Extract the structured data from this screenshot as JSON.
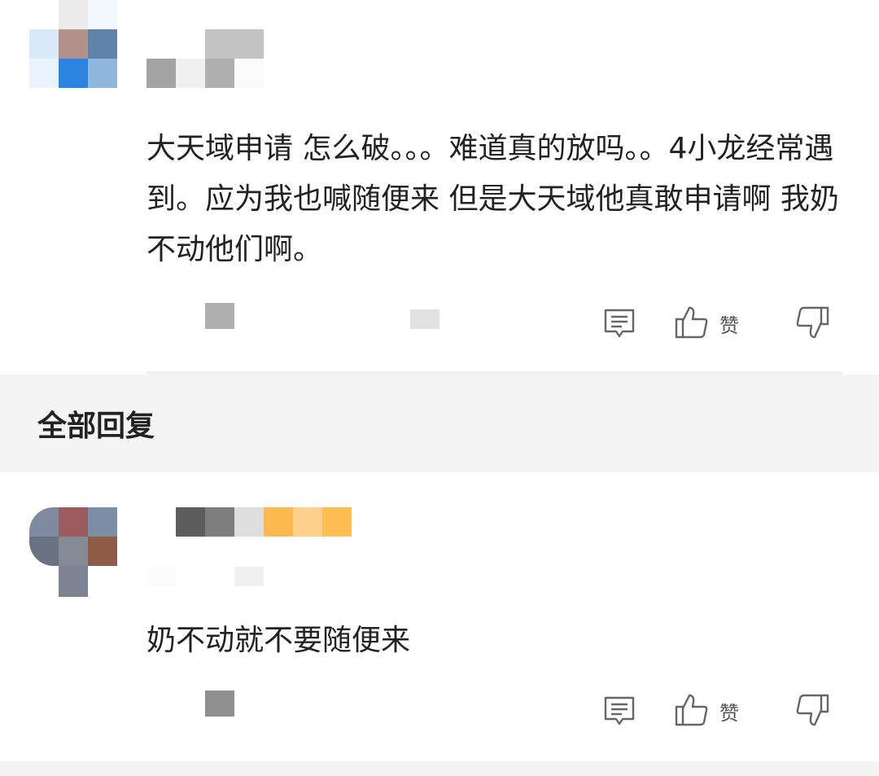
{
  "comment": {
    "text": "大天域申请 怎么破。。。难道真的放吗。。4小龙经常遇到。应为我也喊随便来 但是大天域他真敢申请啊 我奶不动他们啊。",
    "avatar_colors": [
      "#ecebeb",
      "#f3f8fd",
      "#d9ebf8",
      "#b2928b",
      "#5f81aa",
      "#e9f3fb",
      "#2b84df",
      "#8fb6dd"
    ],
    "name_colors": [
      "#c3c3c3",
      "#a3a3a3",
      "#efefef",
      "#b0b0b0",
      "#fafafa"
    ],
    "meta_colors": [
      "#b0b0b0",
      "#e2e2e2"
    ],
    "actions": {
      "reply_icon": "comment-icon",
      "like_icon": "thumbs-up-icon",
      "like_label": "赞",
      "dislike_icon": "thumbs-down-icon"
    }
  },
  "section": {
    "title": "全部回复"
  },
  "reply": {
    "text": "奶不动就不要随便来",
    "avatar_colors": [
      "#7d8aa0",
      "#9c5b5d",
      "#7c8ea6",
      "#6a7382",
      "#858b95",
      "#8f5a46",
      "#7d8393"
    ],
    "name_colors": [
      "#5d5d5d",
      "#7f7f7f",
      "#dedede",
      "#fbb950",
      "#fcd08c",
      "#fdbd52"
    ],
    "meta_colors": [
      "#fbfbfb",
      "#f0f0f0"
    ],
    "stats_colors": [
      "#8f8f8f"
    ],
    "actions": {
      "reply_icon": "comment-icon",
      "like_icon": "thumbs-up-icon",
      "like_label": "赞",
      "dislike_icon": "thumbs-down-icon"
    }
  }
}
